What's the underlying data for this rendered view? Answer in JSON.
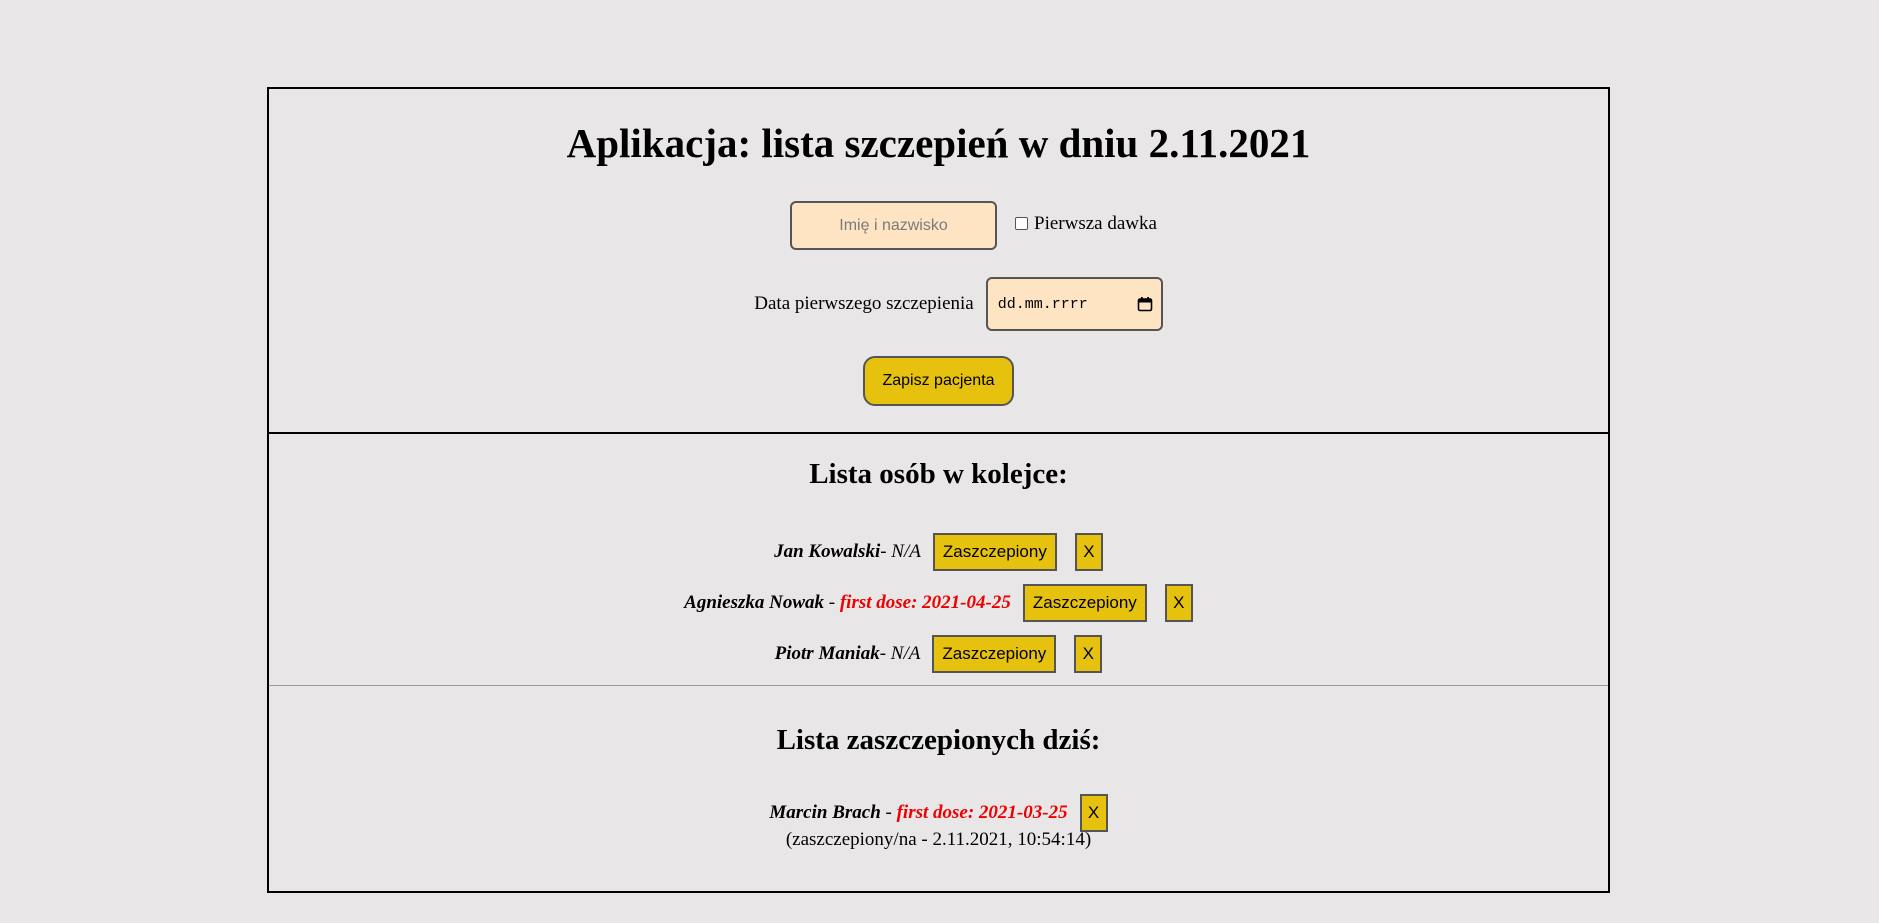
{
  "header": {
    "title": "Aplikacja: lista szczepień w dniu 2.11.2021"
  },
  "form": {
    "name_placeholder": "Imię i nazwisko",
    "first_dose_label": "Pierwsza dawka",
    "date_label": "Data pierwszego szczepienia",
    "date_placeholder": "dd.mm.rrrr",
    "save_label": "Zapisz pacjenta"
  },
  "queue": {
    "title": "Lista osób w kolejce:",
    "vaccinate_label": "Zaszczepiony",
    "remove_label": "X",
    "items": [
      {
        "name": "Jan Kowalski",
        "info": " - N/A"
      },
      {
        "name": "Agnieszka Nowak",
        "sep": " - ",
        "info": "first dose: 2021-04-25"
      },
      {
        "name": "Piotr Maniak",
        "info": " - N/A"
      }
    ]
  },
  "vaccinated": {
    "title": "Lista zaszczepionych dziś:",
    "remove_label": "X",
    "items": [
      {
        "name": "Marcin Brach",
        "sep": " - ",
        "info": "first dose: 2021-03-25",
        "time": "(zaszczepiony/na - 2.11.2021, 10:54:14)"
      }
    ]
  },
  "colors": {
    "background": "#e8e6e7",
    "input_bg": "#ffe4c4",
    "button_bg": "#e6c20f",
    "first_dose": "#e00000"
  }
}
